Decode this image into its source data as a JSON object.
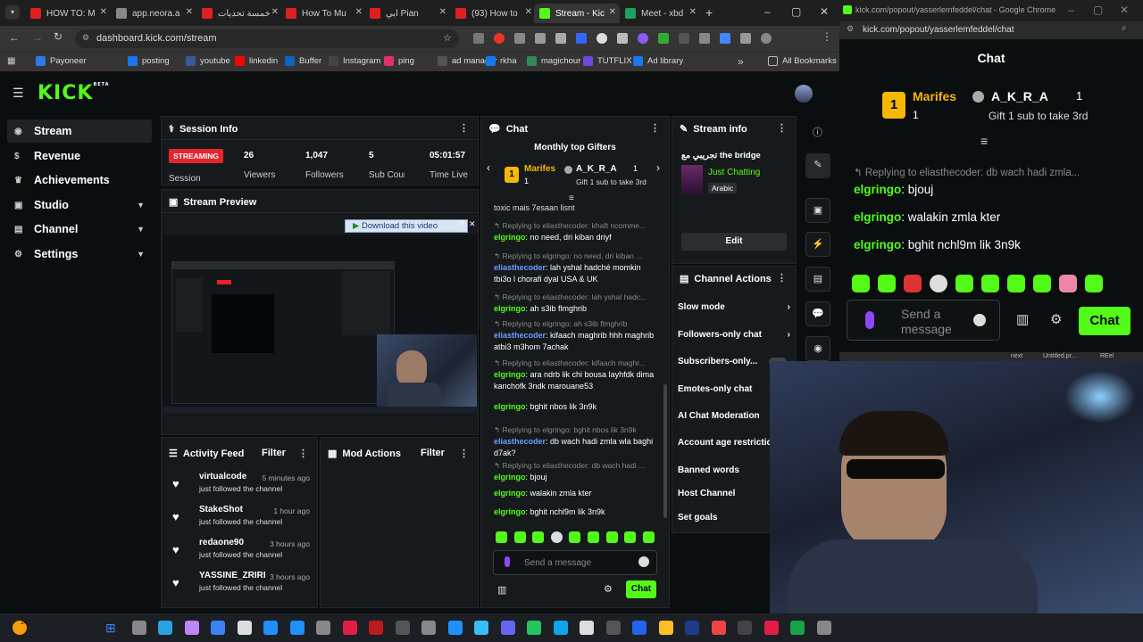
{
  "browser": {
    "tabs": [
      {
        "label": "HOW TO: M",
        "color": "#e02020"
      },
      {
        "label": "app.neora.a",
        "color": "#888"
      },
      {
        "label": "خمسة تحديات",
        "color": "#e02020"
      },
      {
        "label": "How To Mu",
        "color": "#e02020"
      },
      {
        "label": "ابي Pian",
        "color": "#e02020"
      },
      {
        "label": "(93) How to",
        "color": "#e02020"
      },
      {
        "label": "Stream - Kic",
        "color": "#53fc18"
      },
      {
        "label": "Meet - xbd",
        "color": "#1aa260"
      }
    ],
    "url": "dashboard.kick.com/stream",
    "bookmarks": [
      "Payoneer",
      "posting",
      "youtube",
      "linkedin",
      "Buffer",
      "Instagram",
      "ping",
      "ad manager",
      "rkha",
      "magichour",
      "TUTFLIX",
      "Ad library"
    ],
    "all_bookmarks": "All Bookmarks"
  },
  "kick": {
    "logo": "KICK",
    "logo_badge": "BETA",
    "accent": "#53fc18",
    "sidebar": [
      {
        "label": "Stream",
        "icon": "radio-icon",
        "chev": ""
      },
      {
        "label": "Revenue",
        "icon": "dollar-icon",
        "chev": ""
      },
      {
        "label": "Achievements",
        "icon": "trophy-icon",
        "chev": ""
      },
      {
        "label": "Studio",
        "icon": "studio-icon",
        "chev": "▼"
      },
      {
        "label": "Channel",
        "icon": "channel-icon",
        "chev": "▼"
      },
      {
        "label": "Settings",
        "icon": "gear-icon",
        "chev": "▼"
      }
    ],
    "session": {
      "title": "Session Info",
      "status": "STREAMING",
      "status_label": "Session",
      "viewers": "26",
      "viewers_label": "Viewers",
      "followers": "1,047",
      "followers_label": "Followers",
      "subs": "5",
      "subs_label": "Sub Counts",
      "time": "05:01:57",
      "time_label": "Time Live"
    },
    "preview": {
      "title": "Stream Preview",
      "download": "Download this video"
    },
    "activity": {
      "title": "Activity Feed",
      "filter": "Filter",
      "items": [
        {
          "name": "virtualcode",
          "time": "5 minutes ago",
          "text": "just followed the channel"
        },
        {
          "name": "StakeShot",
          "time": "1 hour ago",
          "text": "just followed the channel"
        },
        {
          "name": "redaone90",
          "time": "3 hours ago",
          "text": "just followed the channel"
        },
        {
          "name": "YASSINE_ZRIRI",
          "time": "3 hours ago",
          "text": "just followed the channel"
        }
      ]
    },
    "mod": {
      "title": "Mod Actions",
      "filter": "Filter"
    },
    "chat": {
      "title": "Chat",
      "gifters_title": "Monthly top Gifters",
      "gifter1": "Marifes",
      "gifter1_count": "1",
      "gifter2": "A_K_R_A",
      "gifter2_count": "1",
      "gift_cta": "Gift 1 sub to take 3rd",
      "top_line": "toxic mais 7esaan lisnt",
      "messages": [
        {
          "reply": "Replying to eliasthecoder: khaft ncomme...",
          "name": "elgringo",
          "color": "#53fc18",
          "text": "no need, dri kiban driyf"
        },
        {
          "reply": "Replying to elgringo: no need, dri kiban ...",
          "name": "eliasthecoder",
          "color": "#6b9dff",
          "text": "lah yshal hadché momkin tbi3o l chorafi dyal USA & UK"
        },
        {
          "reply": "Replying to eliasthecoder: lah yshal hadc...",
          "name": "elgringo",
          "color": "#53fc18",
          "text": "ah s3ib flmghrib"
        },
        {
          "reply": "Replying to elgringo: ah s3ib flmghrib",
          "name": "eliasthecoder",
          "color": "#6b9dff",
          "text": "kifaach maghrib hhh maghrib atbi3 m3hom 7achak"
        },
        {
          "reply": "Replying to eliasthecoder: kifaach maghr...",
          "name": "elgringo",
          "color": "#53fc18",
          "text": "ara ndrb lik chi bousa layhfdk dima kanchofk 3ndk marouane53"
        },
        {
          "reply": "",
          "name": "elgringo",
          "color": "#53fc18",
          "text": "bghit nbos lik 3n9k"
        },
        {
          "reply": "Replying to elgringo: bghit nbos lik 3n9k",
          "name": "eliasthecoder",
          "color": "#6b9dff",
          "text": "db wach hadi zmla wla baghi d7ak?"
        },
        {
          "reply": "Replying to eliasthecoder: db wach hadi ...",
          "name": "elgringo",
          "color": "#53fc18",
          "text": "bjouj"
        },
        {
          "reply": "",
          "name": "elgringo",
          "color": "#53fc18",
          "text": "walakin zmla kter"
        },
        {
          "reply": "",
          "name": "elgringo",
          "color": "#53fc18",
          "text": "bghit nchl9m lik 3n9k"
        }
      ],
      "placeholder": "Send a message",
      "send": "Chat"
    },
    "stream_info": {
      "title": "Stream info",
      "stream_title": "تجريبي مع the bridge",
      "category": "Just Chatting",
      "language": "Arabic",
      "edit": "Edit"
    },
    "channel_actions": {
      "title": "Channel Actions",
      "items": [
        {
          "label": "Slow mode",
          "arrow": "›"
        },
        {
          "label": "Followers-only chat",
          "arrow": "›"
        },
        {
          "label": "Subscribers-only...",
          "arrow": ""
        },
        {
          "label": "Emotes-only chat",
          "arrow": ""
        },
        {
          "label": "AI Chat Moderation",
          "arrow": ""
        },
        {
          "label": "Account age restriction",
          "arrow": ""
        },
        {
          "label": "Banned words",
          "arrow": ""
        },
        {
          "label": "Host Channel",
          "arrow": ""
        },
        {
          "label": "Set goals",
          "arrow": ""
        }
      ]
    }
  },
  "popout": {
    "window_title": "kick.com/popout/yasserlemfeddel/chat - Google Chrome",
    "url": "kick.com/popout/yasserlemfeddel/chat",
    "title": "Chat",
    "gifter1": "Marifes",
    "gifter1_count": "1",
    "gifter2": "A_K_R_A",
    "gifter2_count": "1",
    "gift_cta": "Gift 1 sub to take 3rd",
    "reply": "Replying to eliasthecoder: db wach hadi zmla...",
    "messages": [
      {
        "name": "elgringo",
        "text": "bjouj"
      },
      {
        "name": "elgringo",
        "text": "walakin zmla kter"
      },
      {
        "name": "elgringo",
        "text": "bghit nchl9m lik 3n9k"
      }
    ],
    "placeholder": "Send a message",
    "send": "Chat",
    "behind_labels": [
      "next",
      "Untitled.pr...",
      "REel"
    ]
  },
  "taskbar": {
    "badge": "24"
  }
}
